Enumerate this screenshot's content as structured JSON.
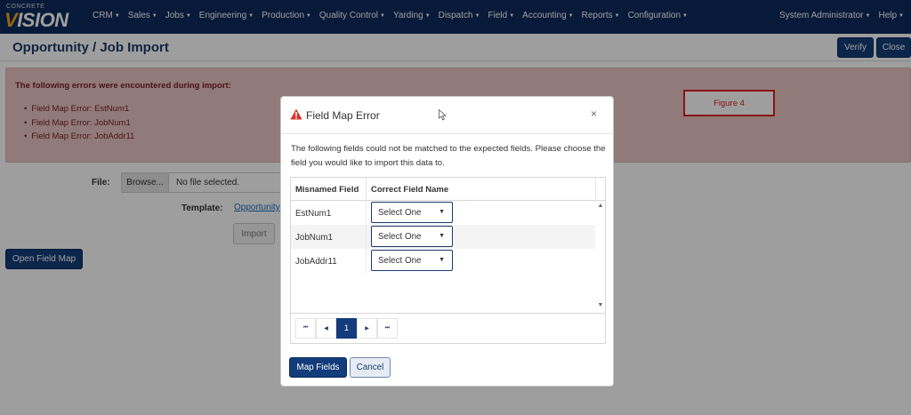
{
  "logo": {
    "small": "CONCRETE",
    "big_prefix": "V",
    "big_rest": "ISION"
  },
  "nav": {
    "items": [
      "CRM",
      "Sales",
      "Jobs",
      "Engineering",
      "Production",
      "Quality Control",
      "Yarding",
      "Dispatch",
      "Field",
      "Accounting",
      "Reports",
      "Configuration"
    ],
    "right": [
      "System Administrator",
      "Help"
    ]
  },
  "page": {
    "title": "Opportunity / Job Import",
    "verify_label": "Verify",
    "close_label": "Close"
  },
  "errors": {
    "title": "The following errors were encountered during import:",
    "items": [
      "Field Map Error: EstNum1",
      "Field Map Error: JobNum1",
      "Field Map Error: JobAddr11"
    ]
  },
  "annotation": {
    "figure_label": "Figure 4"
  },
  "form": {
    "file_label": "File:",
    "browse_label": "Browse...",
    "file_value": "No file selected.",
    "template_label": "Template:",
    "template_link": "Opportunity",
    "import_label": "Import",
    "open_field_map_label": "Open Field Map"
  },
  "modal": {
    "title": "Field Map Error",
    "close_symbol": "×",
    "description": "The following fields could not be matched to the expected fields. Please choose the field you would like to import this data to.",
    "columns": [
      "Misnamed Field",
      "Correct Field Name"
    ],
    "rows": [
      {
        "field": "EstNum1",
        "selection": "Select One"
      },
      {
        "field": "JobNum1",
        "selection": "Select One"
      },
      {
        "field": "JobAddr11",
        "selection": "Select One"
      }
    ],
    "pager": {
      "first": "⏮",
      "prev": "◀",
      "current_page": "1",
      "next": "▶",
      "last": "⏭"
    },
    "map_fields_label": "Map Fields",
    "cancel_label": "Cancel"
  },
  "colors": {
    "brand_navy": "#0e2a5c",
    "button_navy": "#123c7a",
    "error_bg": "#e9c6c6",
    "error_text": "#7a1c1c",
    "annotation_red": "#e01e1e"
  },
  "icons": {
    "warning": "warning-triangle-icon",
    "close": "close-icon",
    "dropdown": "caret-down-icon"
  }
}
